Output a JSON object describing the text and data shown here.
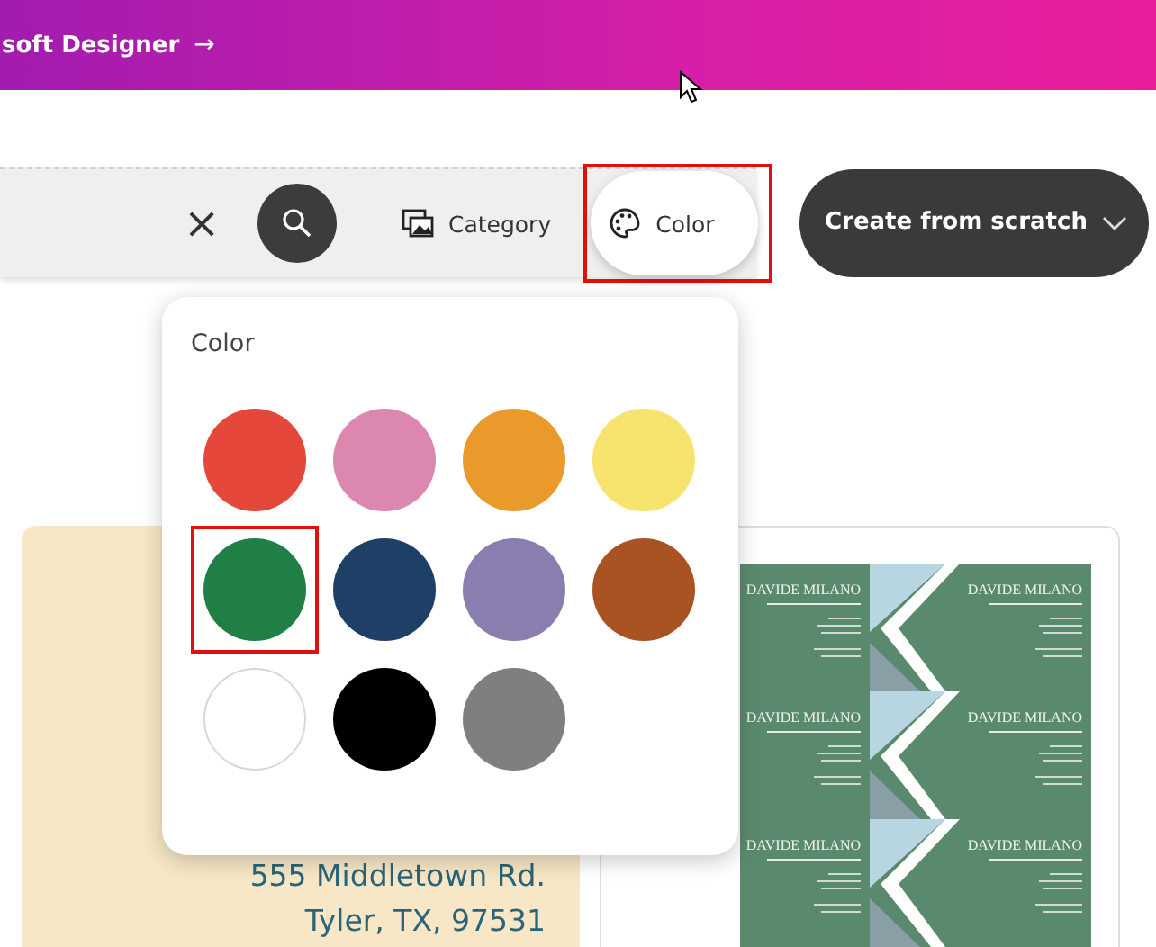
{
  "banner": {
    "text": "soft Designer",
    "arrow": "→"
  },
  "search": {
    "clear": "×"
  },
  "filters": [
    {
      "kind": "category",
      "label": "Category",
      "selected": false
    },
    {
      "kind": "color",
      "label": "Color",
      "selected": true
    }
  ],
  "create_button": {
    "label": "Create from scratch"
  },
  "color_menu": {
    "title": "Color",
    "colors": [
      {
        "color": "#e5473a",
        "selected": false
      },
      {
        "color": "#dc87b0",
        "selected": false
      },
      {
        "color": "#e99a2a",
        "selected": false
      },
      {
        "color": "#f7e46e",
        "selected": false
      },
      {
        "color": "#1f7f45",
        "selected": true
      },
      {
        "color": "#1e3f66",
        "selected": false
      },
      {
        "color": "#8a7db0",
        "selected": false
      },
      {
        "color": "#a95322",
        "selected": false
      },
      {
        "color": "#ffffff",
        "selected": false
      },
      {
        "color": "#000000",
        "selected": false
      },
      {
        "color": "#7f7f7f",
        "selected": false
      }
    ]
  },
  "templates": [
    {
      "kind": "address",
      "lines": [
        "555 Middletown Rd.",
        "Tyler, TX, 97531"
      ]
    },
    {
      "kind": "business_cards",
      "names": [
        "DAVIDE MILANO",
        "DAVIDE MILANO",
        "DAVIDE MILANO",
        "DAVIDE MILANO",
        "DAVIDE MILANO",
        "DAVIDE MILANO"
      ]
    }
  ]
}
